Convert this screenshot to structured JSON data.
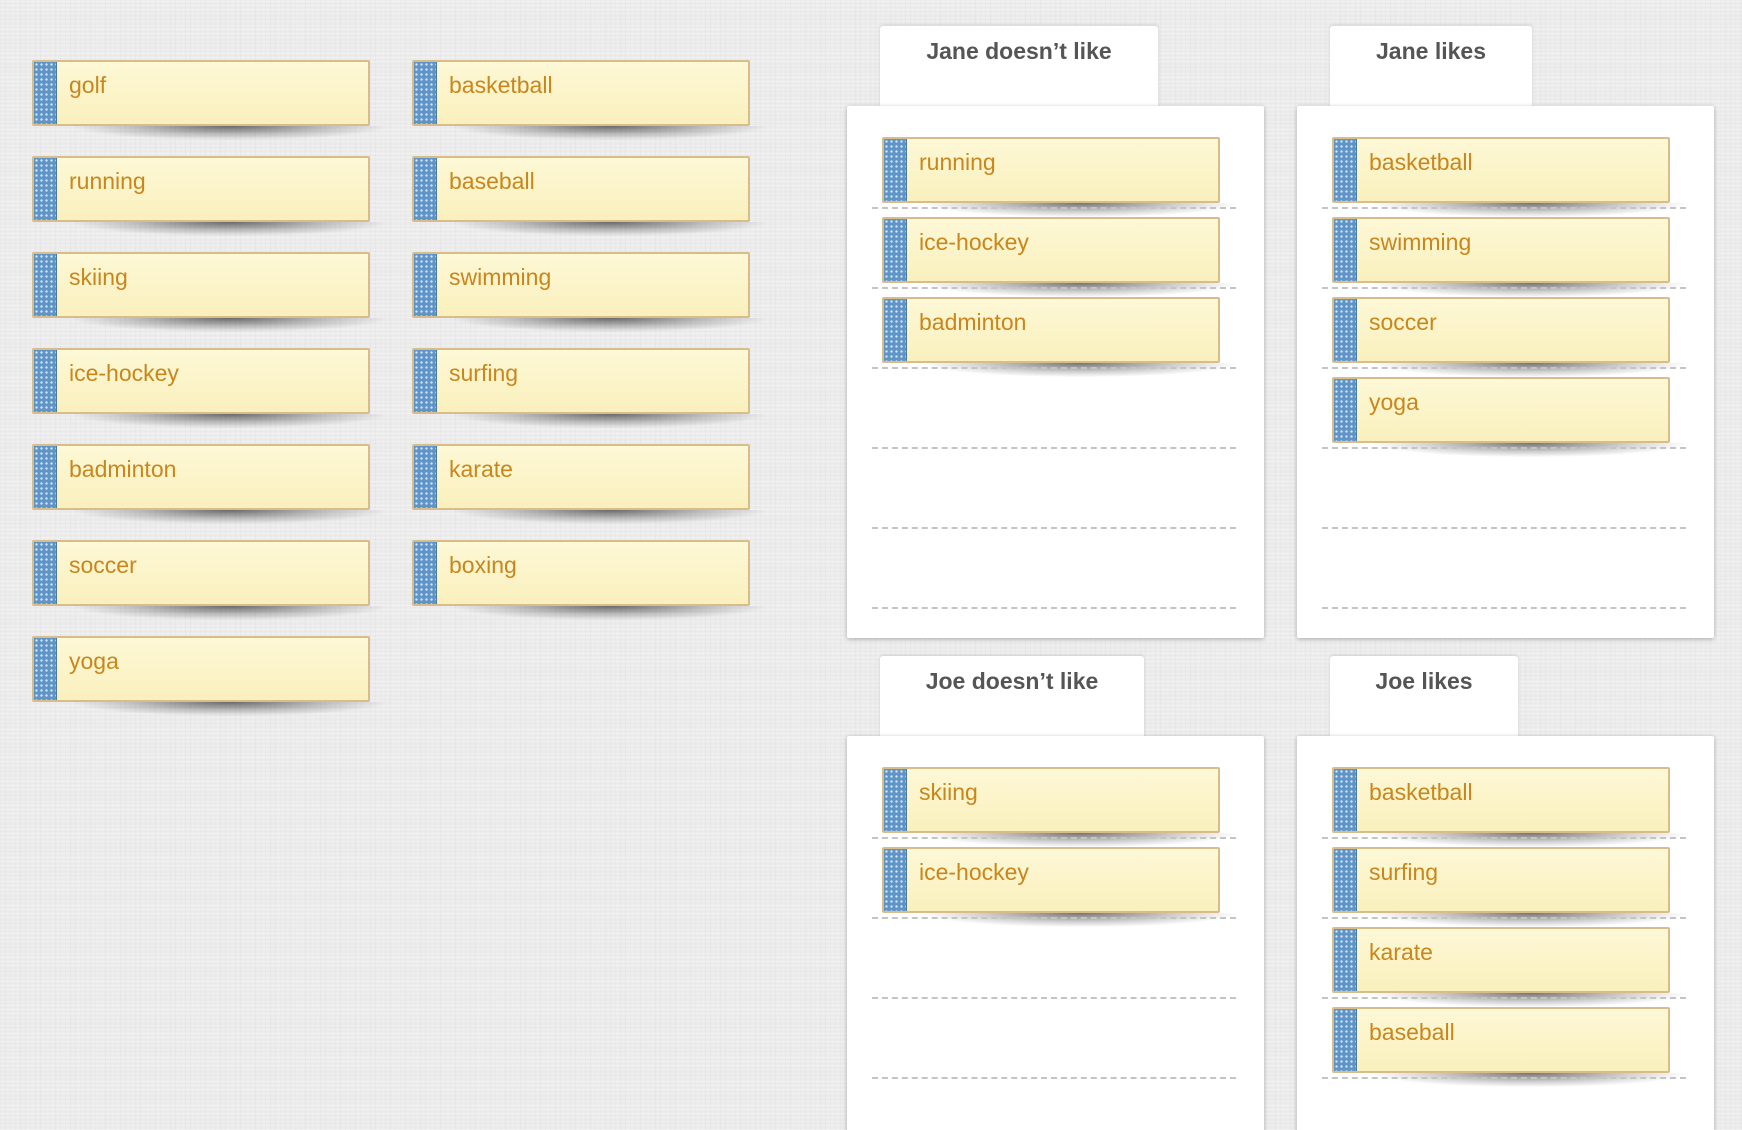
{
  "source_cards": {
    "column_1": [
      "golf",
      "running",
      "skiing",
      "ice-hockey",
      "badminton",
      "soccer",
      "yoga"
    ],
    "column_2": [
      "basketball",
      "baseball",
      "swimming",
      "surfing",
      "karate",
      "boxing"
    ]
  },
  "boxes": {
    "jane_dislikes": {
      "title": "Jane doesn’t like",
      "items": [
        "running",
        "ice-hockey",
        "badminton"
      ]
    },
    "jane_likes": {
      "title": "Jane likes",
      "items": [
        "basketball",
        "swimming",
        "soccer",
        "yoga"
      ]
    },
    "joe_dislikes": {
      "title": "Joe doesn’t like",
      "items": [
        "skiing",
        "ice-hockey"
      ]
    },
    "joe_likes": {
      "title": "Joe likes",
      "items": [
        "basketball",
        "surfing",
        "karate",
        "baseball"
      ]
    }
  },
  "colors": {
    "card_fill": "#faf0bd",
    "card_border": "#d8bd8b",
    "card_text": "#c8861d",
    "grip": "#5f94c6"
  }
}
